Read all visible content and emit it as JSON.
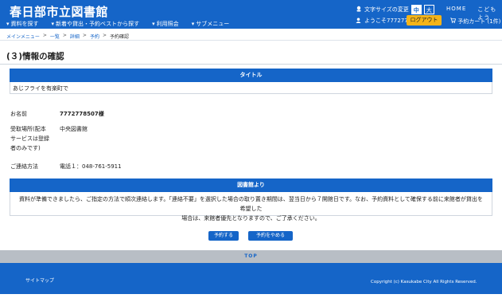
{
  "header": {
    "site_title": "春日部市立図書館",
    "font_size_label": "文字サイズの変更",
    "font_size_medium": "中",
    "font_size_large": "大",
    "home_link": "HOME",
    "kids_link": "こどもよう",
    "user_greeting": "ようこそ7772778507 様",
    "logout_label": "ログアウト",
    "cart_label": "予約カート (1件)"
  },
  "menu": {
    "items": [
      {
        "label": "資料を探す"
      },
      {
        "label": "新着や貸出・予約ベストから探す"
      },
      {
        "label": "利用照会"
      },
      {
        "label": "サブメニュー"
      }
    ]
  },
  "breadcrumb": {
    "items": [
      "メインメニュー",
      "一覧",
      "詳細",
      "予約"
    ],
    "separator": ">",
    "current": "予約確認"
  },
  "page": {
    "heading": "(３)情報の確認"
  },
  "title_box": {
    "header": "タイトル",
    "value": "あじフライを有楽町で"
  },
  "fields": {
    "name_label": "お名前",
    "name_value": "7772778507様",
    "pickup_label_1": "受取場所(配本",
    "pickup_label_2": "サービスは登録",
    "pickup_label_3": "者のみです)",
    "pickup_value": "中央図書館",
    "contact_label": "ご連絡方法",
    "contact_value": "電話１：048-761-5911"
  },
  "notice": {
    "header": "図書館より",
    "line1": "資料が準備できましたら、ご指定の方法で順次連絡します。「連絡不要」を選択した場合の取り置き期間は、翌当日から７開館日です。なお、予約資料として確保する前に来館者が貸出を希望した",
    "line2": "場合は、来館者優先となりますので、ご了承ください。"
  },
  "actions": {
    "reserve_label": "予約する",
    "cancel_label": "予約をやめる"
  },
  "page_top": {
    "label": "TOP"
  },
  "footer": {
    "sitemap": "サイトマップ",
    "copyright": "Copyright (c) Kasukabe City All Rights Reserved."
  },
  "colors": {
    "primary": "#1565c8",
    "accent": "#f4b41a",
    "top_bar": "#b8bec5"
  }
}
